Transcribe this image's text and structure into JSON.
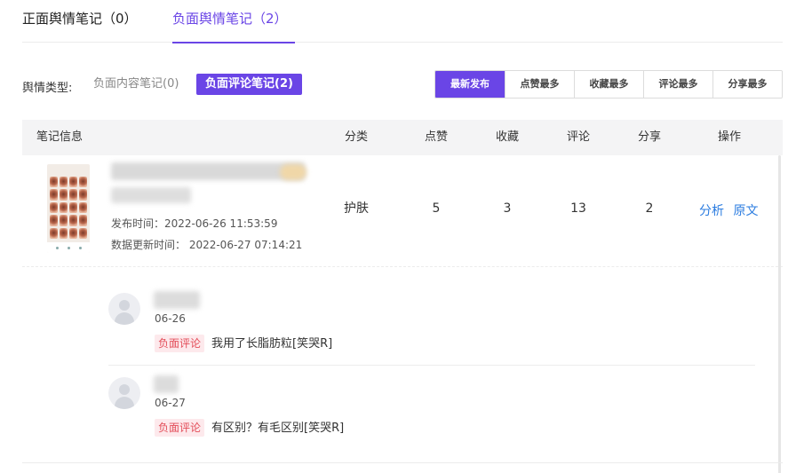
{
  "tabs": [
    {
      "label": "正面舆情笔记（0）",
      "active": false
    },
    {
      "label": "负面舆情笔记（2）",
      "active": true
    }
  ],
  "filter": {
    "label": "舆情类型:",
    "options": [
      {
        "label": "负面内容笔记(0)",
        "active": false
      },
      {
        "label": "负面评论笔记(2)",
        "active": true
      }
    ]
  },
  "sort_buttons": [
    {
      "label": "最新发布",
      "active": true
    },
    {
      "label": "点赞最多",
      "active": false
    },
    {
      "label": "收藏最多",
      "active": false
    },
    {
      "label": "评论最多",
      "active": false
    },
    {
      "label": "分享最多",
      "active": false
    }
  ],
  "table": {
    "headers": [
      "笔记信息",
      "分类",
      "点赞",
      "收藏",
      "评论",
      "分享",
      "操作"
    ],
    "rows": [
      {
        "publish_time": "发布时间：2022-06-26 11:53:59",
        "update_time": "数据更新时间：  2022-06-27 07:14:21",
        "category": "护肤",
        "likes": "5",
        "collects": "3",
        "comments": "13",
        "shares": "2",
        "actions": [
          "分析",
          "原文"
        ]
      }
    ]
  },
  "comments": [
    {
      "date": "06-26",
      "tag": "负面评论",
      "text": "我用了长脂肪粒[笑哭R]"
    },
    {
      "date": "06-27",
      "tag": "负面评论",
      "text": "有区别？有毛区别[笑哭R]"
    }
  ],
  "colors": {
    "accent": "#6a45e6",
    "link": "#2b7ce0",
    "negative_tag_text": "#e34d59",
    "negative_tag_bg": "#fde9ec",
    "header_bg": "#f4f4f5"
  }
}
